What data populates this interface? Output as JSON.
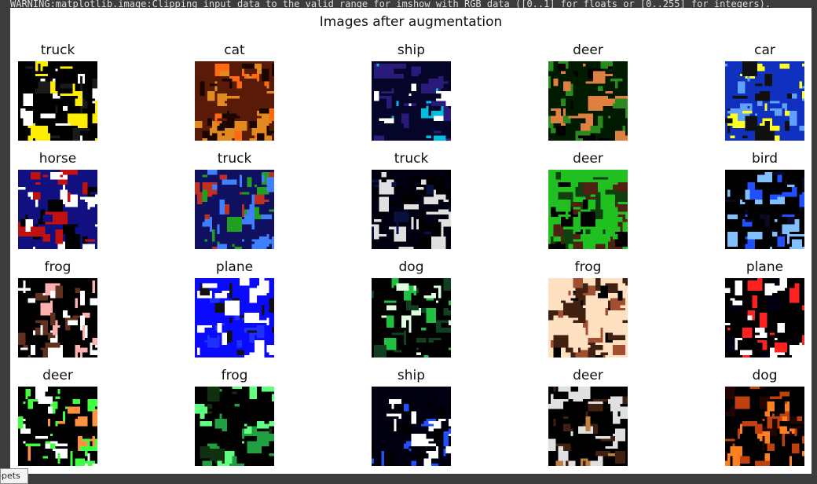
{
  "console": {
    "warning": "WARNING:matplotlib.image:Clipping input data to the valid range for imshow with RGB data ([0..1] for floats or [0..255] for integers)."
  },
  "figure": {
    "title": "Images after augmentation",
    "grid": [
      [
        {
          "label": "truck",
          "palette": [
            "#000000",
            "#ffee00",
            "#ffffff",
            "#1a1a1a"
          ]
        },
        {
          "label": "cat",
          "palette": [
            "#5a1a08",
            "#e08a20",
            "#1a0500",
            "#ff6a10"
          ]
        },
        {
          "label": "ship",
          "palette": [
            "#05052a",
            "#2a1a7a",
            "#00c0e0",
            "#ffffff"
          ]
        },
        {
          "label": "deer",
          "palette": [
            "#001a00",
            "#2a8a20",
            "#e08040",
            "#000000"
          ]
        },
        {
          "label": "car",
          "palette": [
            "#1030c0",
            "#ffff20",
            "#101010",
            "#60a0ff"
          ]
        }
      ],
      [
        {
          "label": "horse",
          "palette": [
            "#101080",
            "#ffffff",
            "#c01010",
            "#000000"
          ]
        },
        {
          "label": "truck",
          "palette": [
            "#101060",
            "#4080ff",
            "#c03020",
            "#20a020"
          ]
        },
        {
          "label": "truck",
          "palette": [
            "#000010",
            "#000000",
            "#e0e0e0",
            "#0a1040"
          ]
        },
        {
          "label": "deer",
          "palette": [
            "#20c020",
            "#104010",
            "#502010",
            "#000000"
          ]
        },
        {
          "label": "bird",
          "palette": [
            "#000000",
            "#2050ff",
            "#80c0ff",
            "#0a0a20"
          ]
        }
      ],
      [
        {
          "label": "frog",
          "palette": [
            "#000000",
            "#ffffff",
            "#603020",
            "#ffb0b0"
          ]
        },
        {
          "label": "plane",
          "palette": [
            "#0a0aff",
            "#ffffff",
            "#101010",
            "#2030ff"
          ]
        },
        {
          "label": "dog",
          "palette": [
            "#000000",
            "#e0ffe0",
            "#20c040",
            "#104020"
          ]
        },
        {
          "label": "frog",
          "palette": [
            "#ffe0c0",
            "#402010",
            "#a05030",
            "#000000"
          ]
        },
        {
          "label": "plane",
          "palette": [
            "#000000",
            "#ffffff",
            "#ff2020",
            "#000010"
          ]
        }
      ],
      [
        {
          "label": "deer",
          "palette": [
            "#000000",
            "#40ff40",
            "#ff9040",
            "#ffffff"
          ]
        },
        {
          "label": "frog",
          "palette": [
            "#000000",
            "#20a040",
            "#60ff80",
            "#103010"
          ]
        },
        {
          "label": "ship",
          "palette": [
            "#000010",
            "#ffffff",
            "#2050ff",
            "#000000"
          ]
        },
        {
          "label": "deer",
          "palette": [
            "#000000",
            "#e0e0e0",
            "#c08040",
            "#402010"
          ]
        },
        {
          "label": "dog",
          "palette": [
            "#000000",
            "#c04010",
            "#ff8020",
            "#200500"
          ]
        }
      ]
    ]
  },
  "footer": {
    "snippets_tab": "ppets"
  }
}
